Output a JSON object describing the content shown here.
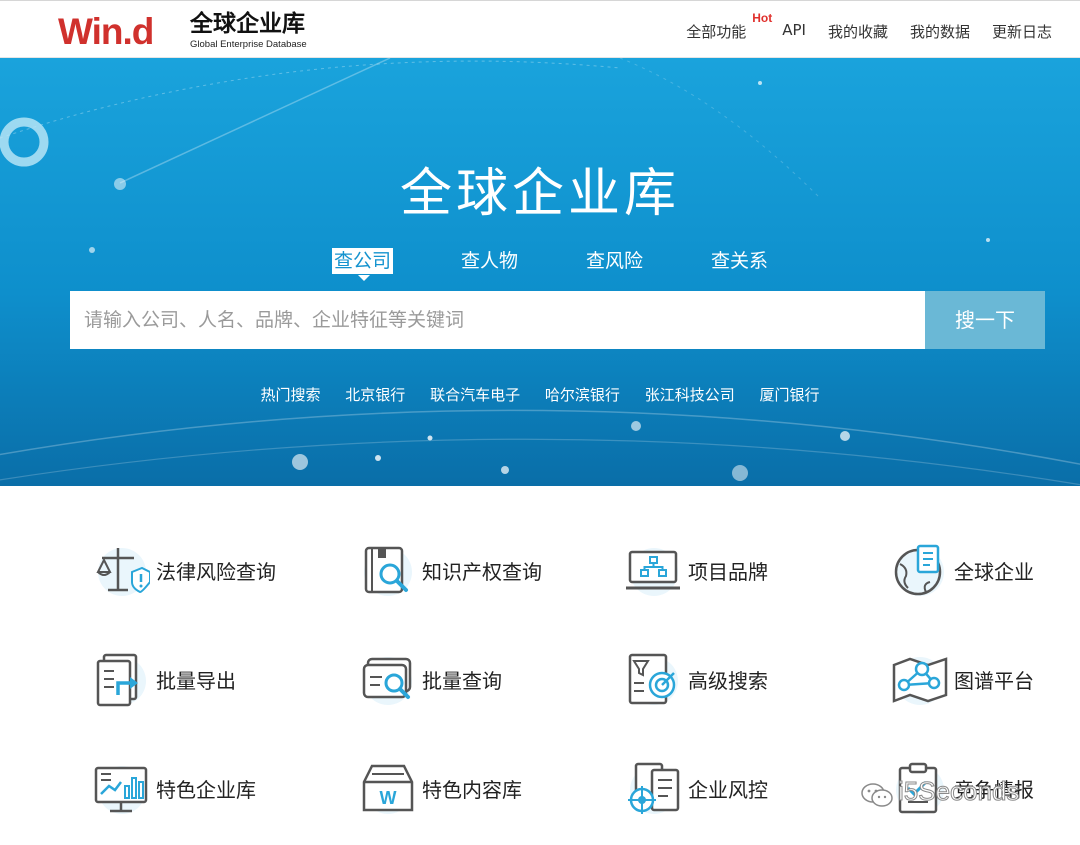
{
  "header": {
    "logo_mark": "Win.d",
    "logo_title": "全球企业库",
    "logo_subtitle": "Global Enterprise Database",
    "nav": [
      {
        "label": "全部功能",
        "badge": "Hot"
      },
      {
        "label": "API"
      },
      {
        "label": "我的收藏"
      },
      {
        "label": "我的数据"
      },
      {
        "label": "更新日志"
      }
    ]
  },
  "hero": {
    "title": "全球企业库",
    "tabs": [
      "查公司",
      "查人物",
      "查风险",
      "查关系"
    ],
    "active_tab": "查公司",
    "search": {
      "placeholder": "请输入公司、人名、品牌、企业特征等关键词",
      "button": "搜一下"
    },
    "hot_searches": {
      "label": "热门搜索",
      "items": [
        "北京银行",
        "联合汽车电子",
        "哈尔滨银行",
        "张江科技公司",
        "厦门银行"
      ]
    }
  },
  "features": [
    {
      "label": "法律风险查询",
      "icon": "scales-icon"
    },
    {
      "label": "知识产权查询",
      "icon": "book-search-icon"
    },
    {
      "label": "项目品牌",
      "icon": "org-chart-monitor-icon"
    },
    {
      "label": "全球企业",
      "icon": "globe-document-icon"
    },
    {
      "label": "批量导出",
      "icon": "document-export-icon"
    },
    {
      "label": "批量查询",
      "icon": "batch-search-icon"
    },
    {
      "label": "高级搜索",
      "icon": "filter-target-icon"
    },
    {
      "label": "图谱平台",
      "icon": "network-map-icon"
    },
    {
      "label": "特色企业库",
      "icon": "monitor-chart-icon"
    },
    {
      "label": "特色内容库",
      "icon": "archive-box-icon"
    },
    {
      "label": "企业风控",
      "icon": "document-crosshair-icon"
    },
    {
      "label": "竞争情报",
      "icon": "clipboard-icon"
    }
  ],
  "watermark": "i5Seconds",
  "colors": {
    "brand_red": "#d0312d",
    "hero_blue": "#1493cf",
    "button_blue": "#6ab8d6",
    "icon_blue": "#2aa6d9",
    "icon_gray": "#555555"
  }
}
